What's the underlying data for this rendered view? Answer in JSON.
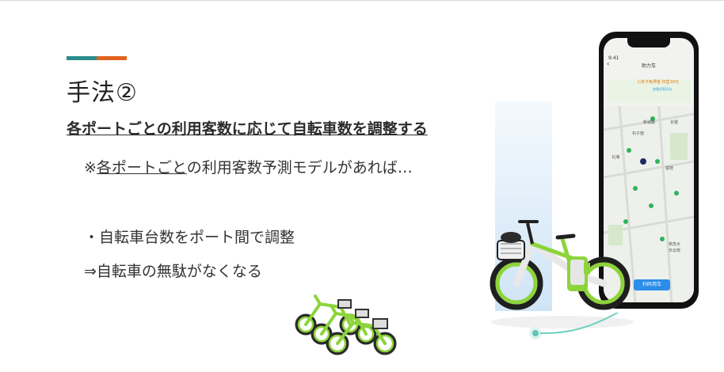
{
  "slide": {
    "title": "手法②",
    "subtitle": "各ポートごとの利用客数に応じて自転車数を調整する",
    "note_prefix": "※",
    "note_underlined": "各ポートごと",
    "note_rest": "の利用客数予測モデルがあれば…",
    "bullet": "・自転車台数をポート間で調整",
    "result": "⇒自転車の無駄がなくなる"
  },
  "phone": {
    "status": "9:41",
    "app_title": "助力车",
    "promo_text": "小安卡免押金·仅售30元",
    "promo_sub": "查看优惠活动",
    "map_labels": [
      "新城路",
      "北埔",
      "石子崮",
      "富桂",
      "长银",
      "常态大",
      "日云校"
    ],
    "ride_button": "扫码用车"
  },
  "colors": {
    "accent_teal": "#2a8c8c",
    "accent_orange": "#e0621e",
    "bike_green": "#8cd43a",
    "ride_blue": "#2a8ee8"
  }
}
